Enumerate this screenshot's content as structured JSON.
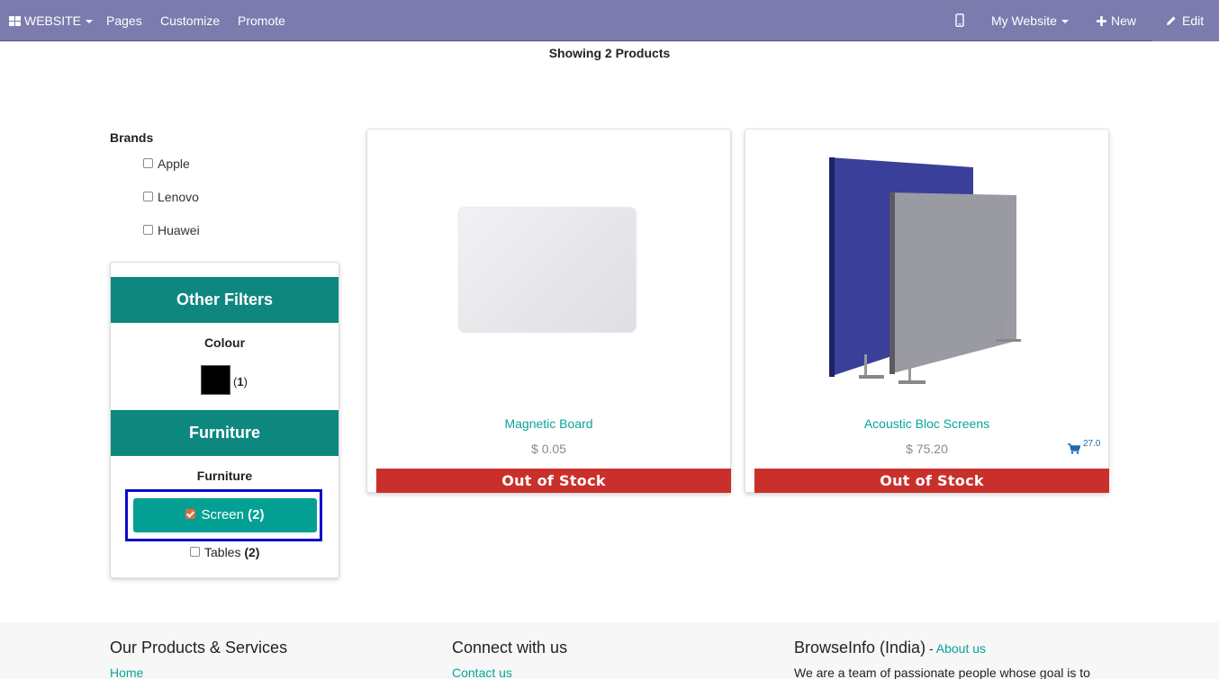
{
  "topbar": {
    "website_menu": "WEBSITE",
    "pages": "Pages",
    "customize": "Customize",
    "promote": "Promote",
    "my_website": "My Website",
    "new": "New",
    "edit": "Edit",
    "background_color": "#7c7bad"
  },
  "catalog": {
    "showing": "Showing 2 Products"
  },
  "brands": {
    "title": "Brands",
    "items": [
      "Apple",
      "Lenovo",
      "Huawei"
    ]
  },
  "filters": {
    "other_filters_title": "Other Filters",
    "colour_label": "Colour",
    "colour_swatch": "#000000",
    "colour_count": "1",
    "furniture_title": "Furniture",
    "furniture_label": "Furniture",
    "screen_label": "Screen",
    "screen_count": "(2)",
    "tables_label": "Tables",
    "tables_count": "(2)",
    "header_color": "#0e877f",
    "active_color": "#04a094"
  },
  "products": [
    {
      "name": "Magnetic Board",
      "price": "$ 0.05",
      "stock": "Out of Stock"
    },
    {
      "name": "Acoustic Bloc Screens",
      "price": "$ 75.20",
      "stock": "Out of Stock",
      "cart_badge": "27.0"
    }
  ],
  "footer": {
    "col1_title": "Our Products & Services",
    "col1_link": "Home",
    "col2_title": "Connect with us",
    "col2_link": "Contact us",
    "col3_title": "BrowseInfo (India)",
    "col3_sep": " - ",
    "col3_link": "About us",
    "col3_text": "We are a team of passionate people whose goal is to"
  }
}
